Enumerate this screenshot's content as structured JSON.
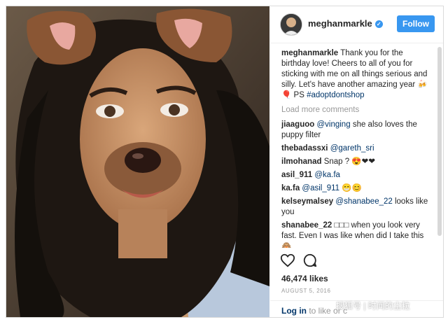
{
  "post": {
    "username": "meghanmarkle",
    "follow_label": "Follow",
    "verified_glyph": "✓",
    "caption_user": "meghanmarkle",
    "caption_text": "Thank you for the birthday love! Cheers to all of you for sticking with me on all things serious and silly. Let's have another amazing year 🍻",
    "caption_ps": "PS",
    "caption_hashtag": "#adoptdontshop",
    "load_more": "Load more comments",
    "likes": "46,474 likes",
    "date": "AUGUST 5, 2016"
  },
  "comments": [
    {
      "user": "jiaaguoo",
      "mention": "@vinging",
      "text": "she also loves the puppy filter"
    },
    {
      "user": "thebadassxi",
      "mention": "@gareth_sri",
      "text": ""
    },
    {
      "user": "ilmohanad",
      "mention": "",
      "text": "Snap ? 😍❤❤"
    },
    {
      "user": "asil_911",
      "mention": "@ka.fa",
      "text": ""
    },
    {
      "user": "ka.fa",
      "mention": "@asil_911",
      "text": "😁😊"
    },
    {
      "user": "kelseymalsey",
      "mention": "@shanabee_22",
      "text": "looks like you"
    },
    {
      "user": "shanabee_22",
      "mention": "",
      "text": "□□□ when you look very fast. Even I was like when did I take this 🙈"
    }
  ],
  "footer": {
    "login_link": "Log in",
    "login_rest": "to like or c"
  },
  "watermark": "搜狐号 | 时间的尘粒",
  "colors": {
    "accent": "#3897f0",
    "link": "#003569",
    "muted": "#999999"
  }
}
